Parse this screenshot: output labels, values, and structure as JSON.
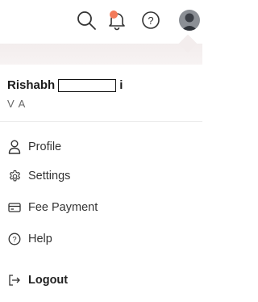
{
  "colors": {
    "accent_dot": "#f27a5a",
    "icon": "#333333"
  },
  "header": {
    "icons": [
      "search-icon",
      "bell-icon",
      "help-icon",
      "avatar"
    ]
  },
  "user": {
    "first_name": "Rishabh",
    "last_initial": "i",
    "subtitle": "V A"
  },
  "menu": {
    "items": [
      {
        "label": "Profile",
        "icon": "user-icon"
      },
      {
        "label": "Settings",
        "icon": "gear-icon"
      },
      {
        "label": "Fee Payment",
        "icon": "card-icon"
      },
      {
        "label": "Help",
        "icon": "help-icon"
      },
      {
        "label": "Logout",
        "icon": "logout-icon"
      }
    ]
  }
}
